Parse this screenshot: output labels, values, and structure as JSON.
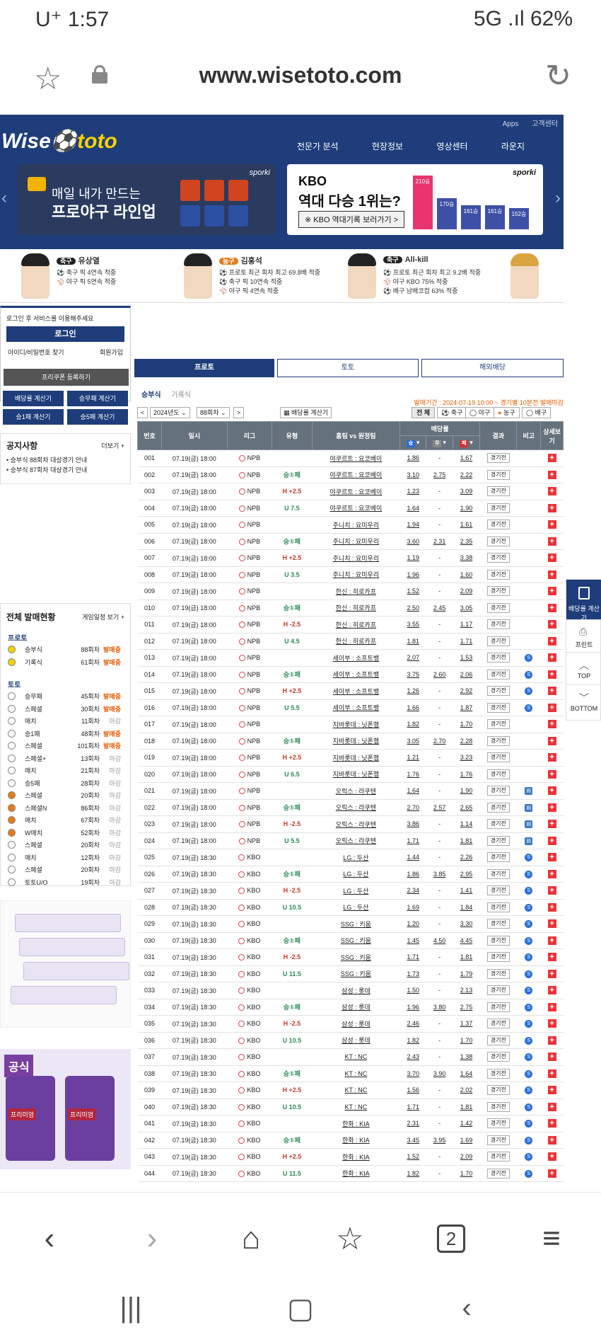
{
  "status": {
    "carrier": "U⁺ 1:57",
    "right": "5G .ıl 62%"
  },
  "browser": {
    "url": "www.wisetoto.com"
  },
  "site": {
    "toplinks": [
      "Apps",
      "고객센터"
    ],
    "logo_a": "Wise",
    "logo_b": "toto",
    "nav": [
      "전문가 분석",
      "현장정보",
      "영상센터",
      "라운지"
    ],
    "banner1": {
      "line1": "매일 내가 만드는",
      "line2": "프로야구 라인업",
      "brand": "sporki"
    },
    "banner2": {
      "title1": "KBO",
      "title2": "역대 다승 1위는?",
      "btn": "※ KBO 역대기록 보러가기 >",
      "brand": "sporki",
      "bars": [
        "210승",
        "170승",
        "161승",
        "161승",
        "152승"
      ]
    },
    "experts": [
      {
        "badge": "축구",
        "name": "유상열",
        "l1": "⚽ 축구 픽 4연속 적중",
        "l2": "⚾ 야구 픽 5연속 적중",
        "l3": ""
      },
      {
        "badge": "농구",
        "name": "김홍석",
        "l1": "⚽ 프로토 최근 회차 최고 69.8배 적중",
        "l2": "⚽ 축구 픽 10연속 적중",
        "l3": "⚾ 야구 픽 4연속 적중"
      },
      {
        "badge": "축구",
        "name": "All-kill",
        "l1": "⚽ 프로토 최근 회차 최고 9.2배 적중",
        "l2": "⚾ 야구 KBO 75% 적중",
        "l3": "⚽ 배구 남배코컵 63% 적중"
      }
    ]
  },
  "left": {
    "login_msg": "로그인 후 서비스를 이용해주세요",
    "login_btn": "로그인",
    "find": "아이디/비밀번호 찾기",
    "join": "회원가입",
    "coupon": "프리쿠폰 등록하기",
    "calc": [
      "배당률 계산기",
      "승무패 계산기",
      "승1패 계산기",
      "승5패 계산기"
    ],
    "notice_title": "공지사항",
    "notice_more": "더보기 +",
    "notices": [
      "승부식 88회차 대상경기 안내",
      "승부식 87회차 대상경기 안내"
    ],
    "sales_title": "전체 발매현황",
    "sales_more": "게임일정 보기 +",
    "sec1": "프로토",
    "sec2": "토토",
    "proto": [
      [
        "승부식",
        "88회차",
        "발매중"
      ],
      [
        "기록식",
        "61회차",
        "발매중"
      ]
    ],
    "toto": [
      [
        "승무패",
        "45회차",
        "발매중"
      ],
      [
        "스페셜",
        "30회차",
        "발매중"
      ],
      [
        "매치",
        "11회차",
        "마감"
      ],
      [
        "승1패",
        "48회차",
        "발매중"
      ],
      [
        "스페셜",
        "101회차",
        "발매중"
      ],
      [
        "스페셜+",
        "13회차",
        "마감"
      ],
      [
        "매치",
        "21회차",
        "마감"
      ],
      [
        "승5패",
        "28회차",
        "마감"
      ],
      [
        "스페셜",
        "20회차",
        "마감"
      ],
      [
        "스페셜N",
        "86회차",
        "마감"
      ],
      [
        "매치",
        "67회차",
        "마감"
      ],
      [
        "W매치",
        "52회차",
        "마감"
      ],
      [
        "스페셜",
        "20회차",
        "마감"
      ],
      [
        "매치",
        "12회차",
        "마감"
      ],
      [
        "스페셜",
        "20회차",
        "마감"
      ],
      [
        "토토U/O",
        "19회차",
        "마감"
      ]
    ],
    "ad_badge": "공식",
    "ad_label": "프리미엄"
  },
  "main": {
    "tabs": [
      "프로토",
      "토토",
      "해외배당"
    ],
    "sub": [
      "승부식",
      "기록식"
    ],
    "period": "발매기간 : 2024-07-19 10:00 ~ 경기별 10분전 발매마감",
    "year": "2024년도",
    "round": "88회차",
    "calc_btn": "배당률 계산기",
    "filters": [
      "전 체",
      "축구",
      "야구",
      "농구",
      "배구"
    ],
    "headers": [
      "번호",
      "일시",
      "리그",
      "유형",
      "홈팀 vs 원정팀",
      "배당률",
      "결과",
      "비고",
      "상세보기"
    ],
    "odds_heads": [
      "승",
      "무",
      "패"
    ],
    "result_btn": "경기전",
    "rows": [
      [
        "001",
        "07.19(금) 18:00",
        "NPB",
        "",
        "야쿠르트 : 요코베이",
        "1.86",
        "-",
        "1.67",
        ""
      ],
      [
        "002",
        "07.19(금) 18:00",
        "NPB",
        "승①패",
        "야쿠르트 : 요코베이",
        "3.10",
        "2.75",
        "2.22",
        ""
      ],
      [
        "003",
        "07.19(금) 18:00",
        "NPB",
        "H +2.5",
        "야쿠르트 : 요코베이",
        "1.23",
        "-",
        "3.09",
        ""
      ],
      [
        "004",
        "07.19(금) 18:00",
        "NPB",
        "U 7.5",
        "야쿠르트 : 요코베이",
        "1.64",
        "-",
        "1.90",
        ""
      ],
      [
        "005",
        "07.19(금) 18:00",
        "NPB",
        "",
        "주니치 : 요미우리",
        "1.94",
        "-",
        "1.61",
        ""
      ],
      [
        "006",
        "07.19(금) 18:00",
        "NPB",
        "승①패",
        "주니치 : 요미우리",
        "3.60",
        "2.31",
        "2.35",
        ""
      ],
      [
        "007",
        "07.19(금) 18:00",
        "NPB",
        "H +2.5",
        "주니치 : 요미우리",
        "1.19",
        "-",
        "3.38",
        ""
      ],
      [
        "008",
        "07.19(금) 18:00",
        "NPB",
        "U 3.5",
        "주니치 : 요미우리",
        "1.96",
        "-",
        "1.60",
        ""
      ],
      [
        "009",
        "07.19(금) 18:00",
        "NPB",
        "",
        "한신 : 히로카프",
        "1.52",
        "-",
        "2.09",
        ""
      ],
      [
        "010",
        "07.19(금) 18:00",
        "NPB",
        "승①패",
        "한신 : 히로카프",
        "2.50",
        "2.45",
        "3.05",
        ""
      ],
      [
        "011",
        "07.19(금) 18:00",
        "NPB",
        "H -2.5",
        "한신 : 히로카프",
        "3.55",
        "-",
        "1.17",
        ""
      ],
      [
        "012",
        "07.19(금) 18:00",
        "NPB",
        "U 4.5",
        "한신 : 히로카프",
        "1.81",
        "-",
        "1.71",
        ""
      ],
      [
        "013",
        "07.19(금) 18:00",
        "NPB",
        "",
        "세이부 : 소프트뱅",
        "2.07",
        "-",
        "1.53",
        "S"
      ],
      [
        "014",
        "07.19(금) 18:00",
        "NPB",
        "승①패",
        "세이부 : 소프트뱅",
        "3.75",
        "2.60",
        "2.06",
        "S"
      ],
      [
        "015",
        "07.19(금) 18:00",
        "NPB",
        "H +2.5",
        "세이부 : 소프트뱅",
        "1.26",
        "-",
        "2.92",
        "S"
      ],
      [
        "016",
        "07.19(금) 18:00",
        "NPB",
        "U 5.5",
        "세이부 : 소프트뱅",
        "1.66",
        "-",
        "1.87",
        "S"
      ],
      [
        "017",
        "07.19(금) 18:00",
        "NPB",
        "",
        "지바롯데 : 닛폰햄",
        "1.82",
        "-",
        "1.70",
        ""
      ],
      [
        "018",
        "07.19(금) 18:00",
        "NPB",
        "승①패",
        "지바롯데 : 닛폰햄",
        "3.05",
        "2.70",
        "2.28",
        ""
      ],
      [
        "019",
        "07.19(금) 18:00",
        "NPB",
        "H +2.5",
        "지바롯데 : 닛폰햄",
        "1.21",
        "-",
        "3.23",
        ""
      ],
      [
        "020",
        "07.19(금) 18:00",
        "NPB",
        "U 6.5",
        "지바롯데 : 닛폰햄",
        "1.76",
        "-",
        "1.76",
        ""
      ],
      [
        "021",
        "07.19(금) 18:00",
        "NPB",
        "",
        "오릭스 : 라쿠텐",
        "1.64",
        "-",
        "1.90",
        "▤"
      ],
      [
        "022",
        "07.19(금) 18:00",
        "NPB",
        "승①패",
        "오릭스 : 라쿠텐",
        "2.70",
        "2.57",
        "2.65",
        "▤"
      ],
      [
        "023",
        "07.19(금) 18:00",
        "NPB",
        "H -2.5",
        "오릭스 : 라쿠텐",
        "3.86",
        "-",
        "1.14",
        "▤"
      ],
      [
        "024",
        "07.19(금) 18:00",
        "NPB",
        "U 5.5",
        "오릭스 : 라쿠텐",
        "1.71",
        "-",
        "1.81",
        "▤"
      ],
      [
        "025",
        "07.19(금) 18:30",
        "KBO",
        "",
        "LG : 두산",
        "1.44",
        "-",
        "2.26",
        "S"
      ],
      [
        "026",
        "07.19(금) 18:30",
        "KBO",
        "승①패",
        "LG : 두산",
        "1.86",
        "3.85",
        "2.95",
        "S"
      ],
      [
        "027",
        "07.19(금) 18:30",
        "KBO",
        "H -2.5",
        "LG : 두산",
        "2.34",
        "-",
        "1.41",
        "S"
      ],
      [
        "028",
        "07.19(금) 18:30",
        "KBO",
        "U 10.5",
        "LG : 두산",
        "1.69",
        "-",
        "1.84",
        "S"
      ],
      [
        "029",
        "07.19(금) 18:30",
        "KBO",
        "",
        "SSG : 키움",
        "1.20",
        "-",
        "3.30",
        "S"
      ],
      [
        "030",
        "07.19(금) 18:30",
        "KBO",
        "승①패",
        "SSG : 키움",
        "1.45",
        "4.50",
        "4.45",
        "S"
      ],
      [
        "031",
        "07.19(금) 18:30",
        "KBO",
        "H -2.5",
        "SSG : 키움",
        "1.71",
        "-",
        "1.81",
        "S"
      ],
      [
        "032",
        "07.19(금) 18:30",
        "KBO",
        "U 11.5",
        "SSG : 키움",
        "1.73",
        "-",
        "1.79",
        "S"
      ],
      [
        "033",
        "07.19(금) 18:30",
        "KBO",
        "",
        "삼성 : 롯데",
        "1.50",
        "-",
        "2.13",
        "S"
      ],
      [
        "034",
        "07.19(금) 18:30",
        "KBO",
        "승①패",
        "삼성 : 롯데",
        "1.96",
        "3.80",
        "2.75",
        "S"
      ],
      [
        "035",
        "07.19(금) 18:30",
        "KBO",
        "H -2.5",
        "삼성 : 롯데",
        "2.46",
        "-",
        "1.37",
        "S"
      ],
      [
        "036",
        "07.19(금) 18:30",
        "KBO",
        "U 10.5",
        "삼성 : 롯데",
        "1.82",
        "-",
        "1.70",
        "S"
      ],
      [
        "037",
        "07.19(금) 18:30",
        "KBO",
        "",
        "KT : NC",
        "2.43",
        "-",
        "1.38",
        "S"
      ],
      [
        "038",
        "07.19(금) 18:30",
        "KBO",
        "승①패",
        "KT : NC",
        "3.70",
        "3.90",
        "1.64",
        "S"
      ],
      [
        "039",
        "07.19(금) 18:30",
        "KBO",
        "H +2.5",
        "KT : NC",
        "1.56",
        "-",
        "2.02",
        "S"
      ],
      [
        "040",
        "07.19(금) 18:30",
        "KBO",
        "U 10.5",
        "KT : NC",
        "1.71",
        "-",
        "1.81",
        "S"
      ],
      [
        "041",
        "07.19(금) 18:30",
        "KBO",
        "",
        "한화 : KIA",
        "2.31",
        "-",
        "1.42",
        "S"
      ],
      [
        "042",
        "07.19(금) 18:30",
        "KBO",
        "승①패",
        "한화 : KIA",
        "3.45",
        "3.95",
        "1.69",
        "S"
      ],
      [
        "043",
        "07.19(금) 18:30",
        "KBO",
        "H +2.5",
        "한화 : KIA",
        "1.52",
        "-",
        "2.09",
        "S"
      ],
      [
        "044",
        "07.19(금) 18:30",
        "KBO",
        "U 11.5",
        "한화 : KIA",
        "1.82",
        "-",
        "1.70",
        "S"
      ]
    ]
  },
  "rail": [
    "배당률 계산기",
    "프린트",
    "TOP",
    "BOTTOM"
  ],
  "bottomnav": [
    "‹",
    "›",
    "⌂",
    "☆",
    "2",
    "≡"
  ],
  "sysnav": [
    "|||",
    "▢",
    "‹"
  ]
}
